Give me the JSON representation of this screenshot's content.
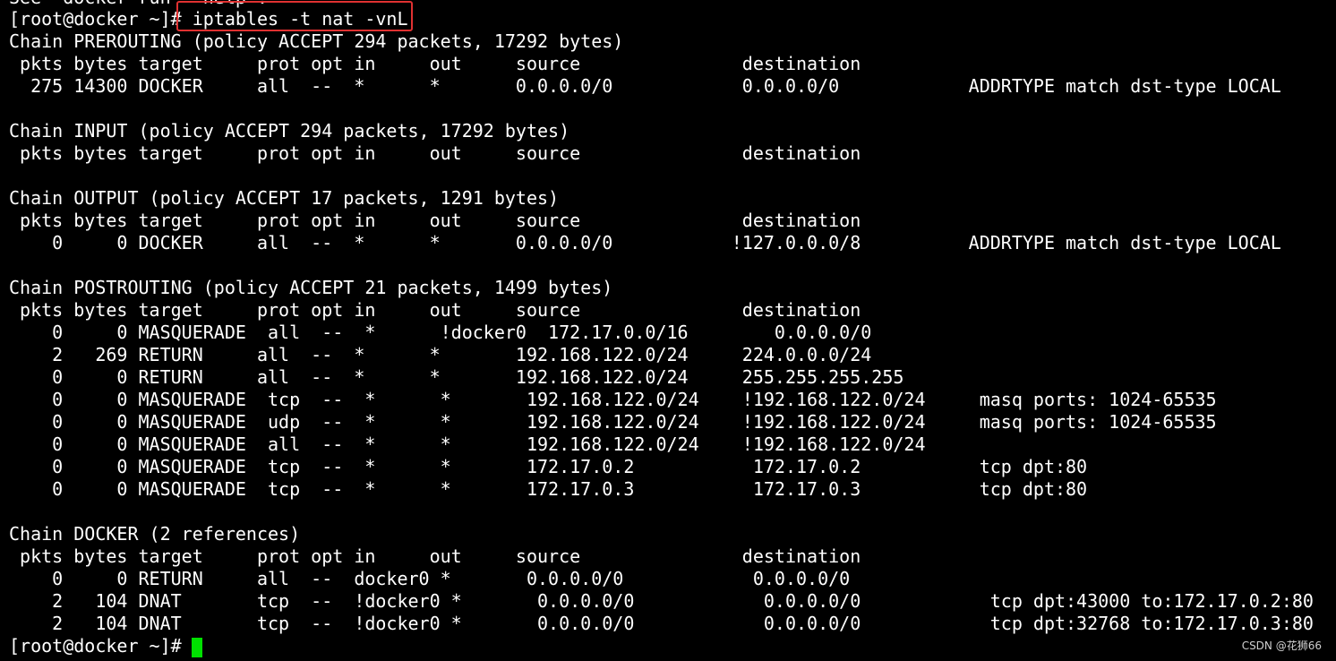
{
  "terminal": {
    "lines": [
      "See 'docker run --help'.",
      "[root@docker ~]# iptables -t nat -vnL",
      "Chain PREROUTING (policy ACCEPT 294 packets, 17292 bytes)",
      " pkts bytes target     prot opt in     out     source               destination",
      "  275 14300 DOCKER     all  --  *      *       0.0.0.0/0            0.0.0.0/0            ADDRTYPE match dst-type LOCAL",
      "",
      "Chain INPUT (policy ACCEPT 294 packets, 17292 bytes)",
      " pkts bytes target     prot opt in     out     source               destination",
      "",
      "Chain OUTPUT (policy ACCEPT 17 packets, 1291 bytes)",
      " pkts bytes target     prot opt in     out     source               destination",
      "    0     0 DOCKER     all  --  *      *       0.0.0.0/0           !127.0.0.0/8          ADDRTYPE match dst-type LOCAL",
      "",
      "Chain POSTROUTING (policy ACCEPT 21 packets, 1499 bytes)",
      " pkts bytes target     prot opt in     out     source               destination",
      "    0     0 MASQUERADE  all  --  *      !docker0  172.17.0.0/16        0.0.0.0/0",
      "    2   269 RETURN     all  --  *      *       192.168.122.0/24     224.0.0.0/24",
      "    0     0 RETURN     all  --  *      *       192.168.122.0/24     255.255.255.255",
      "    0     0 MASQUERADE  tcp  --  *      *       192.168.122.0/24    !192.168.122.0/24     masq ports: 1024-65535",
      "    0     0 MASQUERADE  udp  --  *      *       192.168.122.0/24    !192.168.122.0/24     masq ports: 1024-65535",
      "    0     0 MASQUERADE  all  --  *      *       192.168.122.0/24    !192.168.122.0/24",
      "    0     0 MASQUERADE  tcp  --  *      *       172.17.0.2           172.17.0.2           tcp dpt:80",
      "    0     0 MASQUERADE  tcp  --  *      *       172.17.0.3           172.17.0.3           tcp dpt:80",
      "",
      "Chain DOCKER (2 references)",
      " pkts bytes target     prot opt in     out     source               destination",
      "    0     0 RETURN     all  --  docker0 *       0.0.0.0/0            0.0.0.0/0",
      "    2   104 DNAT       tcp  --  !docker0 *       0.0.0.0/0            0.0.0.0/0            tcp dpt:43000 to:172.17.0.2:80",
      "    2   104 DNAT       tcp  --  !docker0 *       0.0.0.0/0            0.0.0.0/0            tcp dpt:32768 to:172.17.0.3:80",
      "[root@docker ~]# "
    ],
    "cursor_color": "#00e000",
    "highlight_color": "#e03131"
  },
  "watermark": {
    "text": "CSDN @花狮66"
  }
}
